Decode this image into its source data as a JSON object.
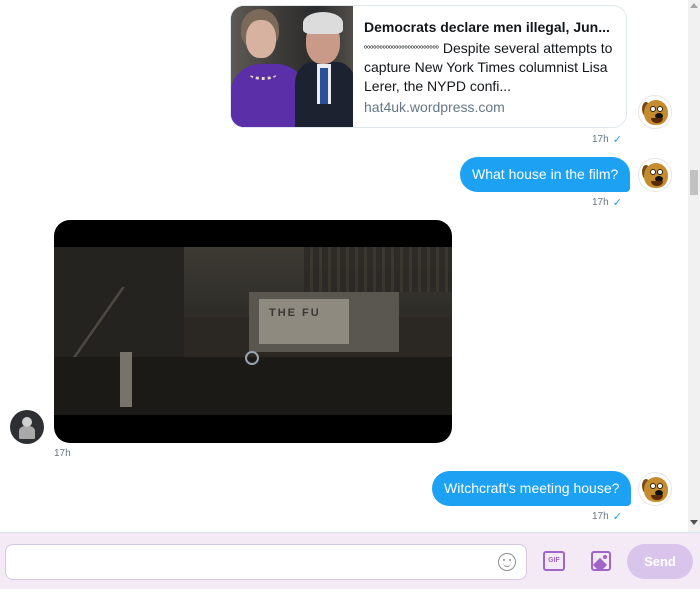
{
  "conversation": {
    "link_card": {
      "title": "Democrats declare men illegal, Jun...",
      "desc_circles": "ºººººººººººººººººººººººº",
      "desc_text": " Despite several attempts to capture New York Times columnist Lisa Lerer, the NYPD confi...",
      "url": "hat4uk.wordpress.com",
      "time": "17h"
    },
    "messages": [
      {
        "text": "What house in the film?",
        "time": "17h"
      },
      {
        "text": "Witchcraft's meeting house?",
        "time": "17h"
      }
    ],
    "video": {
      "sign_text": "THE FU",
      "time": "17h"
    },
    "status_icon": "check-icon"
  },
  "composer": {
    "input_value": "",
    "input_placeholder": "",
    "send_label": "Send",
    "gif_label": "GIF",
    "accent": "#a065c7"
  },
  "colors": {
    "bubble": "#1da1f2",
    "meta": "#657786"
  }
}
